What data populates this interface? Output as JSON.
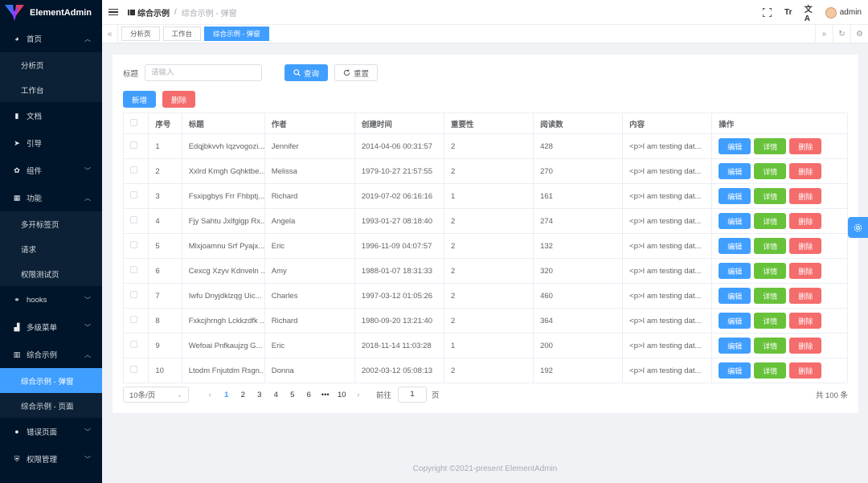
{
  "app": {
    "name": "ElementAdmin"
  },
  "sidebar": {
    "items": [
      {
        "label": "首页",
        "icon": "dashboard-icon",
        "chevron": "up"
      },
      {
        "label": "分析页",
        "sub": true
      },
      {
        "label": "工作台",
        "sub": true
      },
      {
        "label": "文档",
        "icon": "document-icon"
      },
      {
        "label": "引导",
        "icon": "send-icon"
      },
      {
        "label": "组件",
        "icon": "components-icon",
        "chevron": "down"
      },
      {
        "label": "功能",
        "icon": "grid-icon",
        "chevron": "up"
      },
      {
        "label": "多开标签页",
        "sub": true
      },
      {
        "label": "请求",
        "sub": true
      },
      {
        "label": "权限测试页",
        "sub": true
      },
      {
        "label": "hooks",
        "icon": "hooks-icon",
        "chevron": "down"
      },
      {
        "label": "多级菜单",
        "icon": "bar-chart-icon",
        "chevron": "down"
      },
      {
        "label": "综合示例",
        "icon": "example-icon",
        "chevron": "up"
      },
      {
        "label": "综合示例 - 弹窗",
        "sub": true,
        "active": true
      },
      {
        "label": "综合示例 - 页面",
        "sub": true
      },
      {
        "label": "错误页面",
        "icon": "error-icon",
        "chevron": "down"
      },
      {
        "label": "权限管理",
        "icon": "permission-icon",
        "chevron": "down"
      }
    ]
  },
  "header": {
    "breadcrumb_current": "综合示例",
    "breadcrumb_sep": "/",
    "breadcrumb_last": "综合示例 - 弹窗",
    "user": "admin"
  },
  "tabs": [
    {
      "label": "分析页",
      "active": false
    },
    {
      "label": "工作台",
      "active": false
    },
    {
      "label": "综合示例 - 弹窗",
      "active": true
    }
  ],
  "search": {
    "label": "标题",
    "placeholder": "请输入",
    "query_label": "查询",
    "reset_label": "重置"
  },
  "actions": {
    "add_label": "新增",
    "delete_label": "删除"
  },
  "table": {
    "columns": [
      "序号",
      "标题",
      "作者",
      "创建时间",
      "重要性",
      "阅读数",
      "内容",
      "操作"
    ],
    "row_buttons": {
      "edit": "编辑",
      "detail": "详情",
      "delete": "删除"
    },
    "rows": [
      [
        "1",
        "Edqjbkvvh Iqzvogozi...",
        "Jennifer",
        "2014-04-06 00:31:57",
        "2",
        "428",
        "<p>I am testing dat..."
      ],
      [
        "2",
        "Xxlrd Kmgh Gqhktbe...",
        "Melissa",
        "1979-10-27 21:57:55",
        "2",
        "270",
        "<p>I am testing dat..."
      ],
      [
        "3",
        "Fsxipgbys Frr Fhbptj...",
        "Richard",
        "2019-07-02 06:16:16",
        "1",
        "161",
        "<p>I am testing dat..."
      ],
      [
        "4",
        "Fjy Sahtu Jxlfglgp Rx...",
        "Angela",
        "1993-01-27 08:18:40",
        "2",
        "274",
        "<p>I am testing dat..."
      ],
      [
        "5",
        "Mlxjoamnu Srf Pyajx...",
        "Eric",
        "1996-11-09 04:07:57",
        "2",
        "132",
        "<p>I am testing dat..."
      ],
      [
        "6",
        "Cexcg Xzyv Kdnveln ...",
        "Amy",
        "1988-01-07 18:31:33",
        "2",
        "320",
        "<p>I am testing dat..."
      ],
      [
        "7",
        "Iwfu Dnyjdklzqg Uic...",
        "Charles",
        "1997-03-12 01:05:26",
        "2",
        "460",
        "<p>I am testing dat..."
      ],
      [
        "8",
        "Fxkcjhrngh Lckkzdfk ...",
        "Richard",
        "1980-09-20 13:21:40",
        "2",
        "364",
        "<p>I am testing dat..."
      ],
      [
        "9",
        "Wefoai Pnfkaujzg G...",
        "Eric",
        "2018-11-14 11:03:28",
        "1",
        "200",
        "<p>I am testing dat..."
      ],
      [
        "10",
        "Ltodm Fnjutdm Rsgn...",
        "Donna",
        "2002-03-12 05:08:13",
        "2",
        "192",
        "<p>I am testing dat..."
      ]
    ]
  },
  "pagination": {
    "page_size": "10条/页",
    "pages": [
      "1",
      "2",
      "3",
      "4",
      "5",
      "6",
      "•••",
      "10"
    ],
    "current": "1",
    "goto_prefix": "前往",
    "goto_value": "1",
    "goto_suffix": "页",
    "total": "共 100 条"
  },
  "footer": {
    "text": "Copyright ©2021-present ElementAdmin"
  },
  "colors": {
    "primary": "#409eff",
    "success": "#67c23a",
    "danger": "#f56c6c",
    "sidebar": "#001529"
  }
}
